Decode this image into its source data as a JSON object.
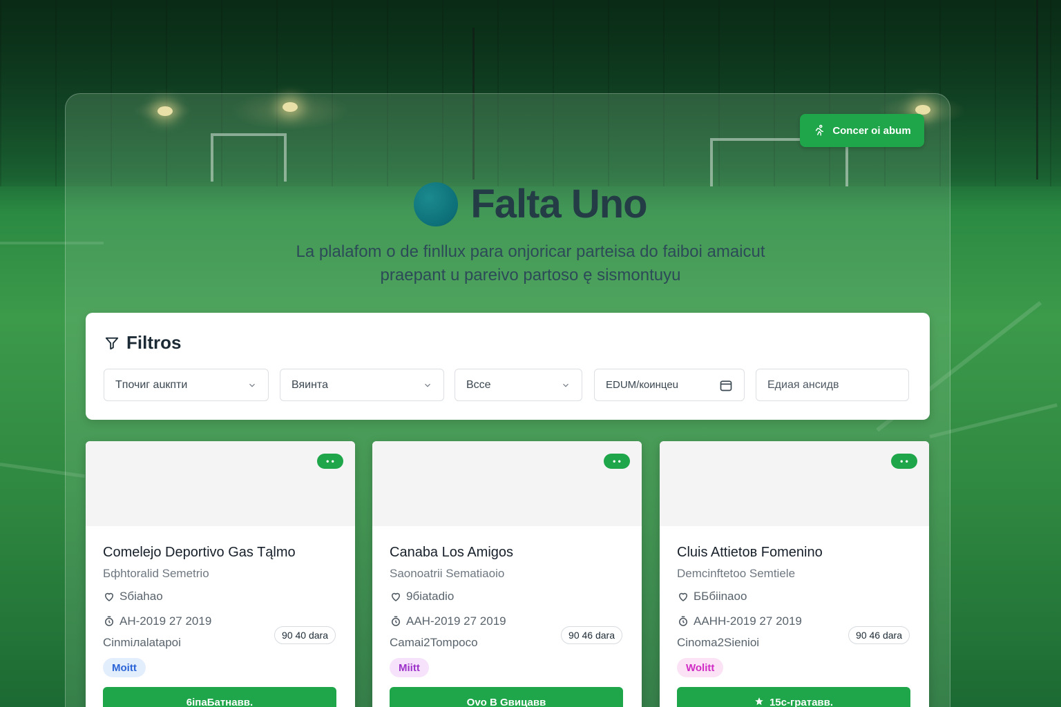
{
  "header": {
    "cta_label": "Concer oi abum",
    "brand_title": "Falta Uno",
    "tagline_line1": "La plalafom o de finllux para onjoricar parteisa do faiboi amaicut",
    "tagline_line2": "praepant u pareivo partoso ę sismontuyu"
  },
  "filters": {
    "title": "Filtros",
    "select1": "Tпочиг аuкпти",
    "select2": "Вяинта",
    "select3": "Вcce",
    "date_value": "EDUM/кoинцеu",
    "search_placeholder": "Eдиая ансидв"
  },
  "cards": [
    {
      "badge": "• •",
      "title": "Comelejo Deportivo Gas Tąlmo",
      "subtitle": "Бфhtoralid Semetrio",
      "location": "Sбiahao",
      "date": "АН-2019 27 2019",
      "price": "90 40 dara",
      "extra": "Cinmiлalatapoi",
      "tag": "Moitt",
      "tag_bg": "#e3eefc",
      "tag_color": "#2b64d6",
      "button": "6іпаБатнавв."
    },
    {
      "badge": "• •",
      "title": "Canaba Los Amigos",
      "subtitle": "Saonoatrii Sematiaoio",
      "location": "9бiatadio",
      "date": "AAH-2019 27 2019",
      "price": "90 46 dara",
      "extra": "Camai2Tompoco",
      "tag": "Miitt",
      "tag_bg": "#f6e3fb",
      "tag_color": "#9b31c9",
      "button": "Ovo B Gвицавв"
    },
    {
      "badge": "• •",
      "title": "Cluis Attietoв Fomenino",
      "subtitle": "Demcinftetoo Semtiele",
      "location": "ББбiinaoo",
      "date": "AAHH-2019 27 2019",
      "price": "90 46 dara",
      "extra": "Cinoma2Sienioi",
      "tag": "Wolitt",
      "tag_bg": "#fbe3f5",
      "tag_color": "#d02bc4",
      "button": "15с-гратавв."
    }
  ],
  "colors": {
    "primary_green": "#1fa64a",
    "brand_text": "#243c46"
  }
}
